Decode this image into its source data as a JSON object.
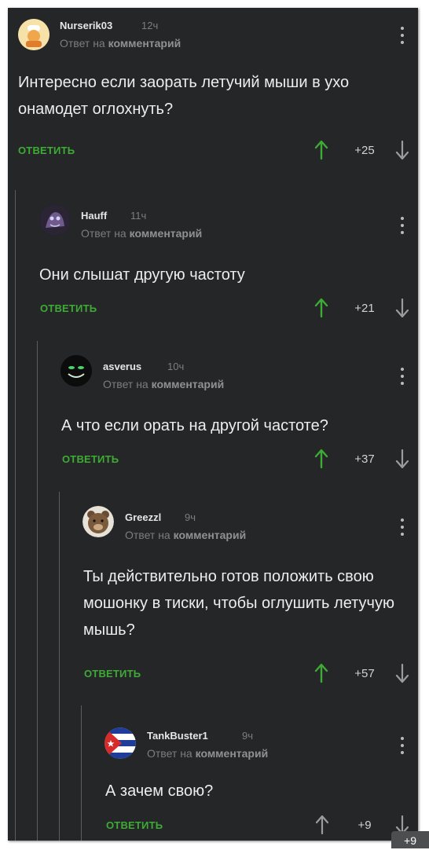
{
  "reply_to_text": "Ответ на",
  "reply_to_target": "комментарий",
  "reply_label": "ОТВЕТИТЬ",
  "comments": [
    {
      "user": "Nurserik03",
      "time": "12ч",
      "text": "Интересно если заорать летучий мыши в ухо онамодет оглохнуть?",
      "rating": "+25",
      "avatar_icon": "chef-avatar-icon"
    },
    {
      "user": "Hauff",
      "time": "11ч",
      "text": "Они слышат другую частоту",
      "rating": "+21",
      "avatar_icon": "creature-avatar-icon"
    },
    {
      "user": "asverus",
      "time": "10ч",
      "text": "А что если орать на другой частоте?",
      "rating": "+37",
      "avatar_icon": "dark-face-avatar-icon"
    },
    {
      "user": "Greezzl",
      "time": "9ч",
      "text": "Ты действительно готов положить свою мошонку в тиски, чтобы оглушить летучую мышь?",
      "rating": "+57",
      "avatar_icon": "bear-avatar-icon"
    },
    {
      "user": "TankBuster1",
      "time": "9ч",
      "text": "А зачем свою?",
      "rating": "+9",
      "avatar_icon": "cuba-flag-avatar-icon"
    }
  ],
  "bottom_badge": "+9",
  "colors": {
    "background": "#242627",
    "accent_green": "#3eab35",
    "text": "#ededed",
    "muted": "#7b7d80"
  }
}
